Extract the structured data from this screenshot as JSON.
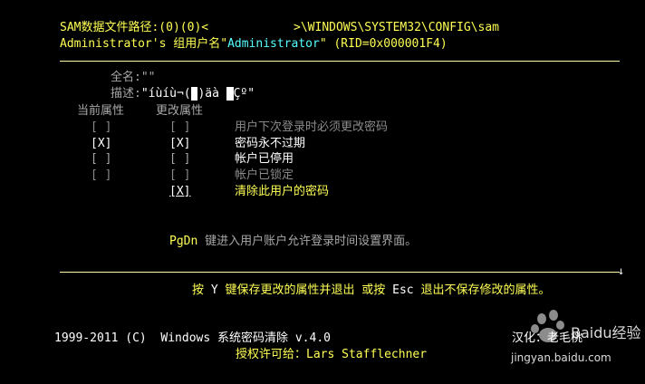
{
  "header": {
    "path_line": "SAM数据文件路径:(0)(0)<            >\\WINDOWS\\SYSTEM32\\CONFIG\\sam",
    "user_prefix": "Administrator's 组用户名\"",
    "user_name": "Administrator",
    "user_suffix": "\" (RID=0x000001F4)"
  },
  "fields": {
    "fullname_label": "全名:",
    "fullname_value": "\"\"",
    "desc_label": "描述:",
    "desc_value_a": "\"íùíù¬(",
    "desc_value_b": ")äà ",
    "desc_value_c": "Çº\""
  },
  "columns": {
    "current": "当前属性",
    "change": "更改属性"
  },
  "attributes": [
    {
      "current": "[ ]",
      "change": "[ ]",
      "label": "用户下次登录时必须更改密码",
      "active": false
    },
    {
      "current": "[X]",
      "change": "[X]",
      "label": "密码永不过期",
      "active": true
    },
    {
      "current": "[ ]",
      "change": "[ ]",
      "label": "帐户已停用",
      "active": true
    },
    {
      "current": "[ ]",
      "change": "[ ]",
      "label": "帐户已锁定",
      "active": false
    },
    {
      "current": "",
      "change": "[X]",
      "label": "清除此用户的密码",
      "active": true
    }
  ],
  "pgdn": {
    "key": "PgDn",
    "text": " 键进入用户账户允许登录时间设置界面。"
  },
  "footer_hint": {
    "p1": "按 ",
    "key_y": "Y",
    "p2": " 键保存更改的属性并退出 或按 ",
    "key_esc": "Esc",
    "p3": " 退出不保存修改的属性。",
    "arrow": "↓"
  },
  "credits": {
    "line1": "1999-2011 (C)  Windows 系统密码清除 v.4.0",
    "line2_label": "授权许可给：",
    "line2_name": "Lars Stafflechner",
    "tail": "汉化：老毛桃"
  },
  "watermark": {
    "brand": "Baidu经验",
    "url": "jingyan.baidu.com"
  },
  "colors": {
    "background": "#000000",
    "highlight": "#ffff55",
    "accent": "#55ffff",
    "text": "#c0c0c0"
  }
}
